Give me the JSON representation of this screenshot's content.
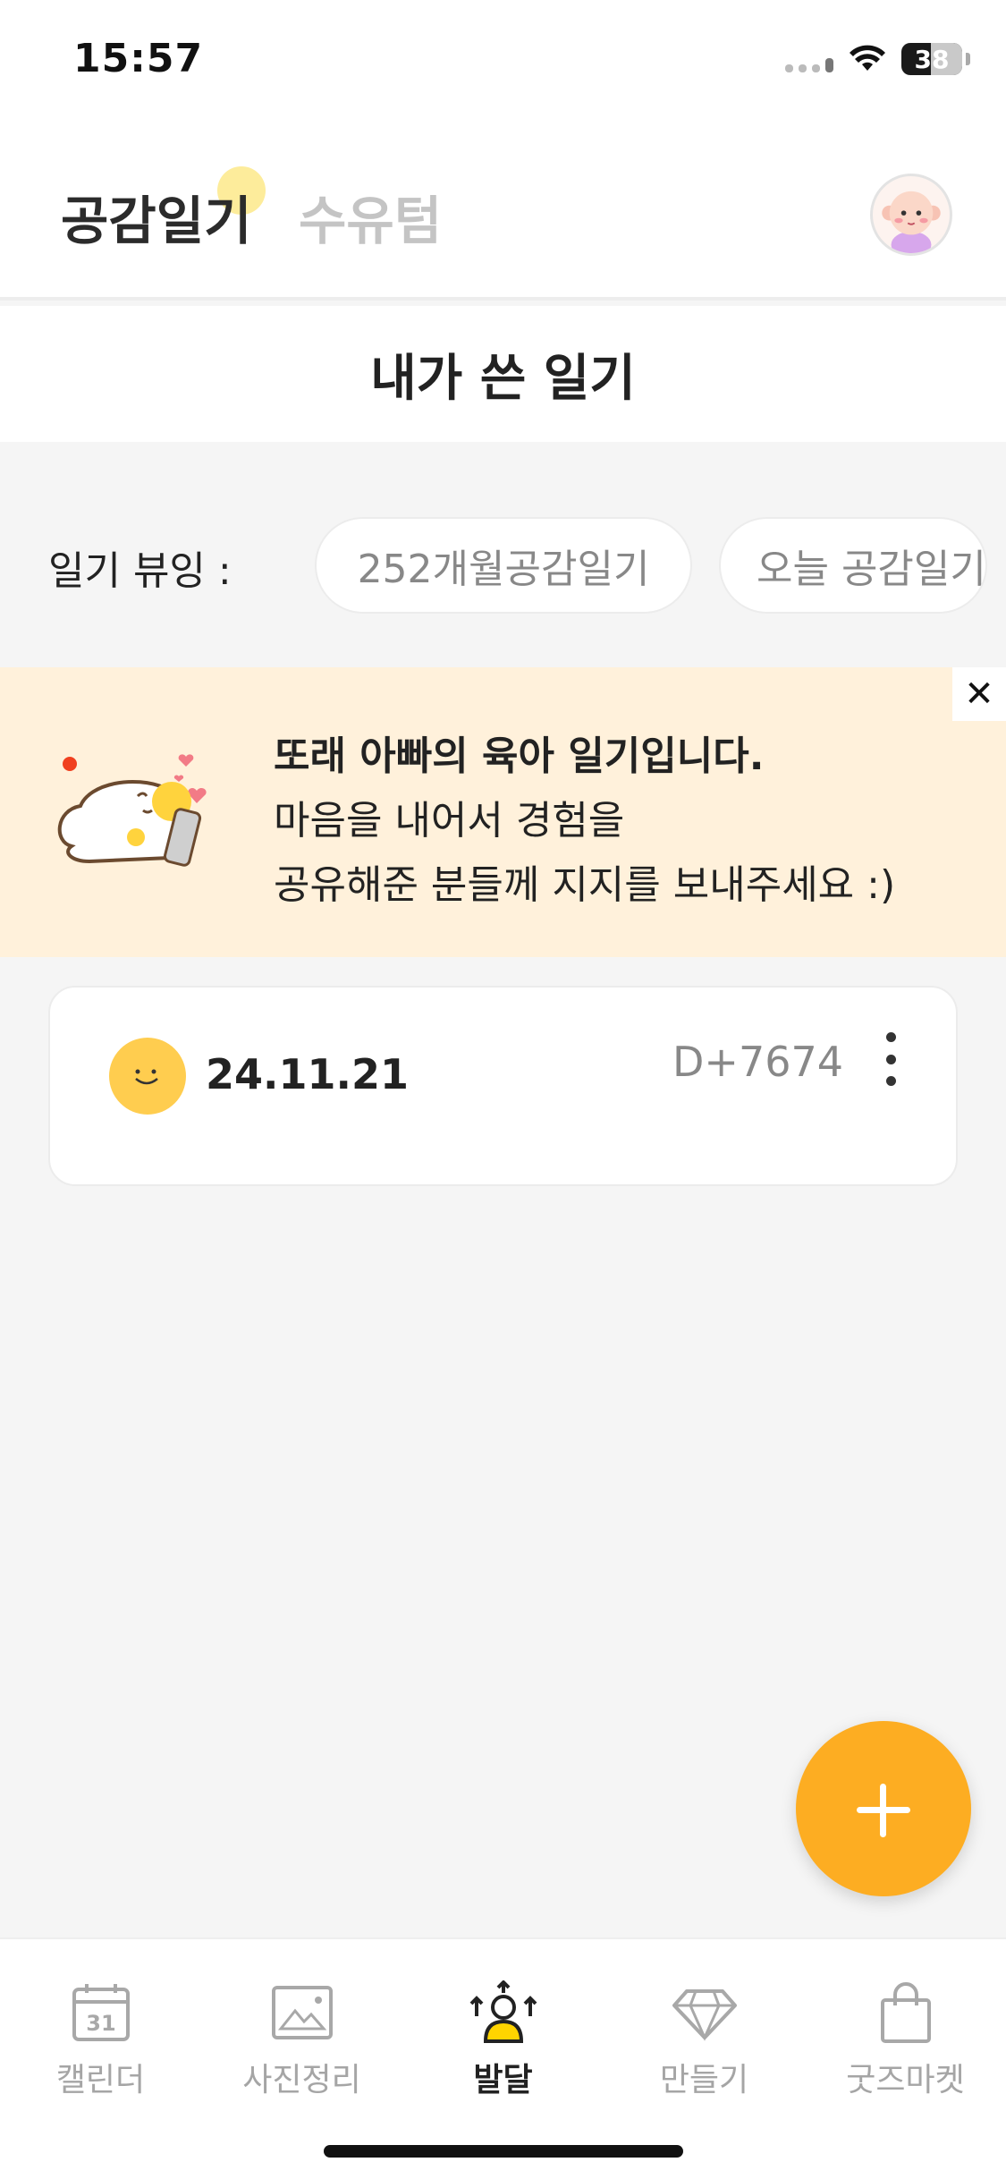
{
  "status_bar": {
    "time": "15:57",
    "battery": "38"
  },
  "header": {
    "tabs": [
      {
        "label": "공감일기",
        "active": true
      },
      {
        "label": "수유텀",
        "active": false
      }
    ]
  },
  "page_title": "내가 쓴 일기",
  "diary_viewing": {
    "label": "일기 뷰잉 :",
    "chips": [
      "252개월공감일기",
      "오늘 공감일기"
    ]
  },
  "banner": {
    "line1": "또래 아빠의 육아 일기입니다.",
    "line2": "마음을 내어서 경험을",
    "line3": "공유해준 분들께 지지를 보내주세요 :)",
    "close_icon": "close-icon"
  },
  "diary_entries": [
    {
      "date": "24.11.21",
      "dday": "D+7674",
      "mood_icon": "smile-face-icon"
    }
  ],
  "fab": {
    "icon": "plus-icon"
  },
  "bottom_nav": {
    "items": [
      {
        "label": "캘린더",
        "icon": "calendar-icon",
        "calendar_day": "31",
        "active": false
      },
      {
        "label": "사진정리",
        "icon": "photo-icon",
        "active": false
      },
      {
        "label": "발달",
        "icon": "growth-icon",
        "active": true
      },
      {
        "label": "만들기",
        "icon": "diamond-icon",
        "active": false
      },
      {
        "label": "굿즈마켓",
        "icon": "shopping-bag-icon",
        "active": false
      }
    ]
  },
  "colors": {
    "accent": "#fdad22",
    "banner_bg": "#fff1db",
    "tab_dot": "#fde98a",
    "mood_face": "#ffcd4f",
    "active_nav_icon": "#ffd400"
  }
}
